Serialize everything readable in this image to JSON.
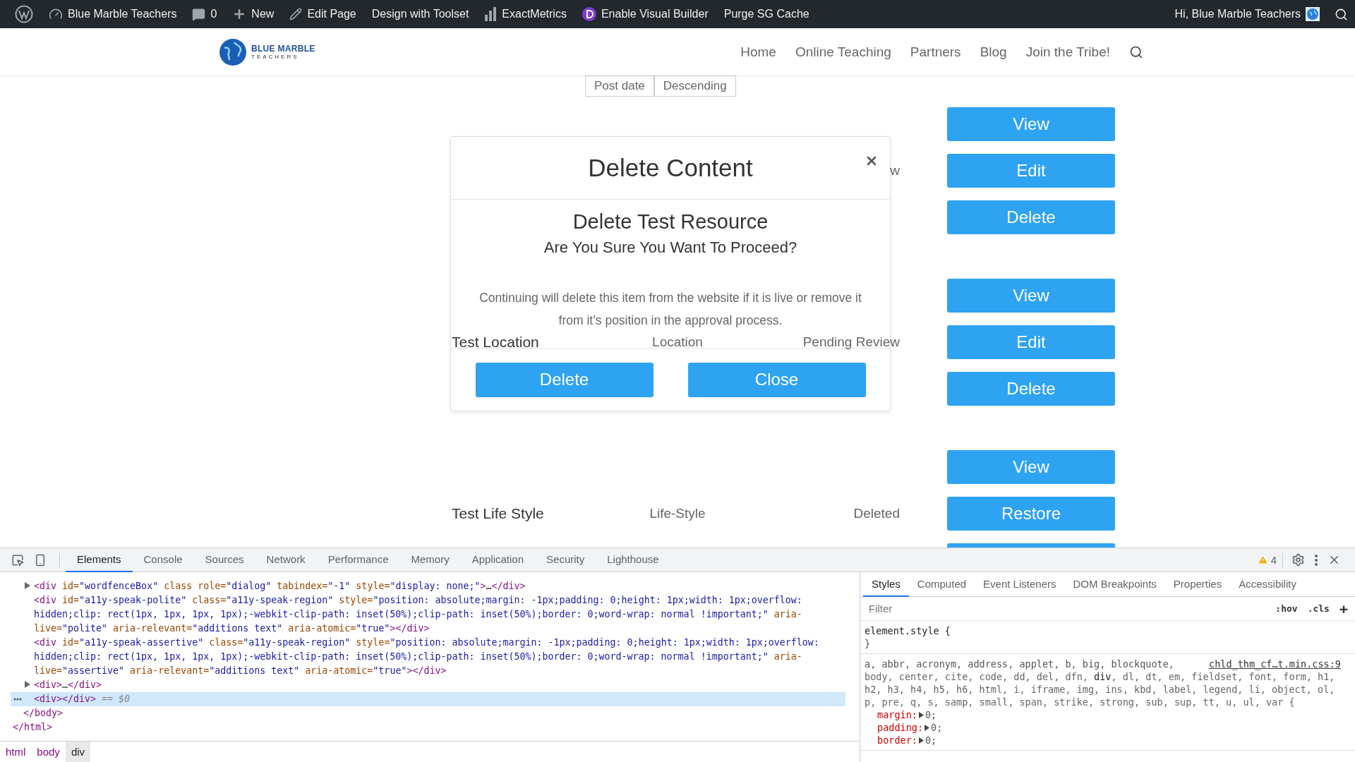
{
  "admin_bar": {
    "items": [
      {
        "kind": "wp-logo"
      },
      {
        "kind": "site",
        "label": "Blue Marble Teachers"
      },
      {
        "kind": "comments",
        "label": "0"
      },
      {
        "kind": "new",
        "label": "New"
      },
      {
        "kind": "edit",
        "label": "Edit Page"
      },
      {
        "kind": "plain",
        "label": "Design with Toolset"
      },
      {
        "kind": "metrics",
        "label": "ExactMetrics"
      },
      {
        "kind": "builder",
        "label": "Enable Visual Builder"
      },
      {
        "kind": "plain",
        "label": "Purge SG Cache"
      }
    ],
    "greeting": "Hi, Blue Marble Teachers"
  },
  "site_header": {
    "logo": {
      "name": "BLUE MARBLE",
      "tagline": "TEACHERS"
    },
    "nav": [
      "Home",
      "Online Teaching",
      "Partners",
      "Blog",
      "Join the Tribe!"
    ]
  },
  "sort_controls": [
    "Post date",
    "Descending"
  ],
  "listing": {
    "groups": [
      {
        "row": {
          "status": "w"
        },
        "actions": [
          "View",
          "Edit",
          "Delete"
        ]
      },
      {
        "row": {
          "title": "Test Location",
          "category": "Location",
          "status": "Pending Review"
        },
        "actions": [
          "View",
          "Edit",
          "Delete"
        ]
      },
      {
        "row": {
          "title": "Test Life Style",
          "category": "Life-Style",
          "status": "Deleted"
        },
        "actions": [
          "View",
          "Restore"
        ],
        "partial_button": true
      }
    ]
  },
  "dialog": {
    "title": "Delete Content",
    "heading": "Delete Test Resource",
    "question": "Are You Sure You Want To Proceed?",
    "message": "Continuing will delete this item from the website if it is live or remove it from it’s position in the approval process.",
    "buttons": [
      "Delete",
      "Close"
    ]
  },
  "devtools": {
    "tabs": [
      {
        "label": "Elements",
        "selected": true
      },
      {
        "label": "Console",
        "selected": false
      },
      {
        "label": "Sources",
        "selected": false
      },
      {
        "label": "Network",
        "selected": false
      },
      {
        "label": "Performance",
        "selected": false
      },
      {
        "label": "Memory",
        "selected": false
      },
      {
        "label": "Application",
        "selected": false
      },
      {
        "label": "Security",
        "selected": false
      },
      {
        "label": "Lighthouse",
        "selected": false
      }
    ],
    "warnings": "4",
    "tree": {
      "kind": "group",
      "closing": "</html>",
      "children": [
        {
          "kind": "group",
          "closing": "</body>",
          "children": [
            {
              "kind": "line",
              "expandable": true,
              "selected": false,
              "tokens": [
                {
                  "kind": "tag",
                  "text": "<div"
                },
                {
                  "kind": "attr",
                  "text": " id="
                },
                {
                  "kind": "val",
                  "text": "\"wordfenceBox\""
                },
                {
                  "kind": "attr",
                  "text": " class role="
                },
                {
                  "kind": "val",
                  "text": "\"dialog\""
                },
                {
                  "kind": "attr",
                  "text": " tabindex="
                },
                {
                  "kind": "val",
                  "text": "\"-1\""
                },
                {
                  "kind": "attr",
                  "text": " style="
                },
                {
                  "kind": "val",
                  "text": "\"display: none;\""
                },
                {
                  "kind": "tag",
                  "text": ">"
                },
                {
                  "kind": "plain",
                  "text": "…"
                },
                {
                  "kind": "tag",
                  "text": "</div>"
                }
              ]
            },
            {
              "kind": "line",
              "expandable": false,
              "selected": false,
              "tokens": [
                {
                  "kind": "tag",
                  "text": "<div"
                },
                {
                  "kind": "attr",
                  "text": " id="
                },
                {
                  "kind": "val",
                  "text": "\"a11y-speak-polite\""
                },
                {
                  "kind": "attr",
                  "text": " class="
                },
                {
                  "kind": "val",
                  "text": "\"a11y-speak-region\""
                },
                {
                  "kind": "attr",
                  "text": " style="
                },
                {
                  "kind": "val",
                  "text": "\"position: absolute;margin: -1px;padding: 0;height: 1px;width: 1px;overflow: hidden;clip: rect(1px, 1px, 1px, 1px);-webkit-clip-path: inset(50%);clip-path: inset(50%);border: 0;word-wrap: normal !important;\""
                },
                {
                  "kind": "attr",
                  "text": " aria-live="
                },
                {
                  "kind": "val",
                  "text": "\"polite\""
                },
                {
                  "kind": "attr",
                  "text": " aria-relevant="
                },
                {
                  "kind": "val",
                  "text": "\"additions text\""
                },
                {
                  "kind": "attr",
                  "text": " aria-atomic="
                },
                {
                  "kind": "val",
                  "text": "\"true\""
                },
                {
                  "kind": "tag",
                  "text": "></div>"
                }
              ]
            },
            {
              "kind": "line",
              "expandable": false,
              "selected": false,
              "tokens": [
                {
                  "kind": "tag",
                  "text": "<div"
                },
                {
                  "kind": "attr",
                  "text": " id="
                },
                {
                  "kind": "val",
                  "text": "\"a11y-speak-assertive\""
                },
                {
                  "kind": "attr",
                  "text": " class="
                },
                {
                  "kind": "val",
                  "text": "\"a11y-speak-region\""
                },
                {
                  "kind": "attr",
                  "text": " style="
                },
                {
                  "kind": "val",
                  "text": "\"position: absolute;margin: -1px;padding: 0;height: 1px;width: 1px;overflow: hidden;clip: rect(1px, 1px, 1px, 1px);-webkit-clip-path: inset(50%);clip-path: inset(50%);border: 0;word-wrap: normal !important;\""
                },
                {
                  "kind": "attr",
                  "text": " aria-live="
                },
                {
                  "kind": "val",
                  "text": "\"assertive\""
                },
                {
                  "kind": "attr",
                  "text": " aria-relevant="
                },
                {
                  "kind": "val",
                  "text": "\"additions text\""
                },
                {
                  "kind": "attr",
                  "text": " aria-atomic="
                },
                {
                  "kind": "val",
                  "text": "\"true\""
                },
                {
                  "kind": "tag",
                  "text": "></div>"
                }
              ]
            },
            {
              "kind": "line",
              "expandable": true,
              "selected": false,
              "tokens": [
                {
                  "kind": "tag",
                  "text": "<div>"
                },
                {
                  "kind": "plain",
                  "text": "…"
                },
                {
                  "kind": "tag",
                  "text": "</div>"
                }
              ]
            },
            {
              "kind": "line",
              "expandable": false,
              "selected": true,
              "tokens": [
                {
                  "kind": "tag",
                  "text": "<div></div>"
                },
                {
                  "kind": "ref",
                  "text": " == $0"
                }
              ]
            }
          ]
        }
      ]
    },
    "breadcrumbs": [
      {
        "label": "html",
        "selected": false
      },
      {
        "label": "body",
        "selected": false
      },
      {
        "label": "div",
        "selected": true
      }
    ],
    "styles": {
      "tabs": [
        {
          "label": "Styles",
          "selected": true
        },
        {
          "label": "Computed",
          "selected": false
        },
        {
          "label": "Event Listeners",
          "selected": false
        },
        {
          "label": "DOM Breakpoints",
          "selected": false
        },
        {
          "label": "Properties",
          "selected": false
        },
        {
          "label": "Accessibility",
          "selected": false
        }
      ],
      "filter_placeholder": "Filter",
      "buttons": [
        ":hov",
        ".cls",
        "+"
      ],
      "rules": [
        {
          "selector_parts": [
            {
              "text": "element.style {",
              "matched": true
            }
          ],
          "closing": "}"
        },
        {
          "source": "chld_thm_cf…t.min.css:9",
          "selector_first_line": "a, abbr, acronym, address, applet, b, big, blockquote,",
          "selector_parts": [
            {
              "text": "body, center, cite, code, dd, del, dfn, ",
              "matched": false
            },
            {
              "text": "div",
              "matched": true
            },
            {
              "text": ", dl, dt, em, fieldset, font, form, h1, h2, h3, h4, h5, h6, html, i, iframe, img, ins, kbd, label, legend, li, object, ol, p, pre, q, s, samp, small, span, strike, strong, sub, sup, tt, u, ul, var {",
              "matched": false
            }
          ],
          "properties": [
            {
              "name": "margin:",
              "value": "0;"
            },
            {
              "name": "padding:",
              "value": "0;"
            },
            {
              "name": "border:",
              "value": "0;"
            }
          ]
        }
      ]
    }
  }
}
